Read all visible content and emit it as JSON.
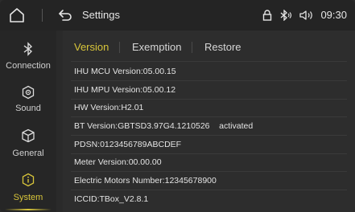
{
  "topbar": {
    "title": "Settings",
    "time": "09:30",
    "icons": [
      "home-icon",
      "back-icon",
      "lock-icon",
      "bluetooth-icon",
      "volume-icon"
    ]
  },
  "sidebar": {
    "items": [
      {
        "label": "Connection",
        "icon": "bluetooth-icon",
        "active": false
      },
      {
        "label": "Sound",
        "icon": "sound-icon",
        "active": false
      },
      {
        "label": "General",
        "icon": "cube-icon",
        "active": false
      },
      {
        "label": "System",
        "icon": "info-icon",
        "active": true
      }
    ]
  },
  "tabs": [
    {
      "label": "Version",
      "active": true
    },
    {
      "label": "Exemption",
      "active": false
    },
    {
      "label": "Restore",
      "active": false
    }
  ],
  "info": [
    "IHU MCU Version:05.00.15",
    "IHU MPU Version:05.00.12",
    "HW Version:H2.01",
    "BT Version:GBTSD3.97G4.1210526    activated",
    "PDSN:0123456789ABCDEF",
    "Meter Version:00.00.00",
    "Electric Motors Number:12345678900",
    "ICCID:TBox_V2.8.1"
  ],
  "colors": {
    "accent": "#d8c53a",
    "background": "#2a2a2a",
    "text": "#e4e4e4"
  }
}
